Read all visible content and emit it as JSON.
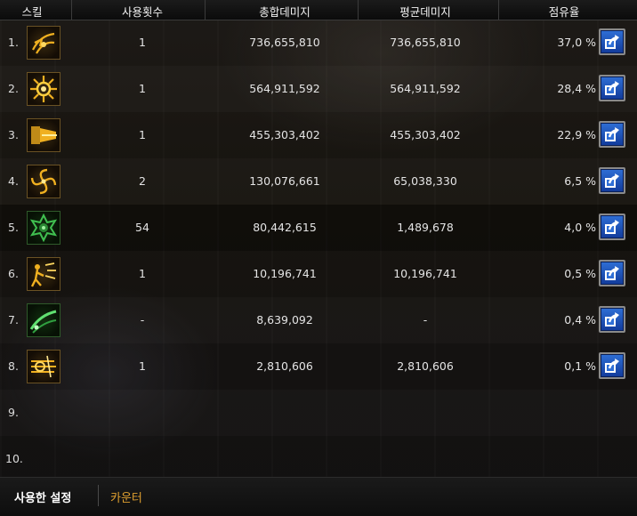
{
  "header": {
    "skill": "스킬",
    "uses": "사용횟수",
    "total_damage": "총합데미지",
    "avg_damage": "평균데미지",
    "share": "점유율"
  },
  "rows": [
    {
      "index": "1.",
      "icon": "skill-icon-gold-slash",
      "uses": "1",
      "total": "736,655,810",
      "avg": "736,655,810",
      "share": "37,0 %"
    },
    {
      "index": "2.",
      "icon": "skill-icon-gold-burst",
      "uses": "1",
      "total": "564,911,592",
      "avg": "564,911,592",
      "share": "28,4 %"
    },
    {
      "index": "3.",
      "icon": "skill-icon-gold-beam",
      "uses": "1",
      "total": "455,303,402",
      "avg": "455,303,402",
      "share": "22,9 %"
    },
    {
      "index": "4.",
      "icon": "skill-icon-gold-vortex",
      "uses": "2",
      "total": "130,076,661",
      "avg": "65,038,330",
      "share": "6,5 %"
    },
    {
      "index": "5.",
      "icon": "skill-icon-green-aura",
      "uses": "54",
      "total": "80,442,615",
      "avg": "1,489,678",
      "share": "4,0 %"
    },
    {
      "index": "6.",
      "icon": "skill-icon-gold-strike",
      "uses": "1",
      "total": "10,196,741",
      "avg": "10,196,741",
      "share": "0,5 %"
    },
    {
      "index": "7.",
      "icon": "skill-icon-green-wave",
      "uses": "-",
      "total": "8,639,092",
      "avg": "-",
      "share": "0,4 %"
    },
    {
      "index": "8.",
      "icon": "skill-icon-gold-flurry",
      "uses": "1",
      "total": "2,810,606",
      "avg": "2,810,606",
      "share": "0,1 %"
    },
    {
      "index": "9."
    },
    {
      "index": "10."
    }
  ],
  "share_button_icon": "share-export-icon",
  "footer": {
    "tab_active": "사용한 설정",
    "tab_inactive": "카운터"
  },
  "colors": {
    "accent_orange": "#e0a030",
    "button_blue": "#2f6fd6",
    "icon_gold": "#f0b020",
    "icon_green": "#40c050"
  }
}
